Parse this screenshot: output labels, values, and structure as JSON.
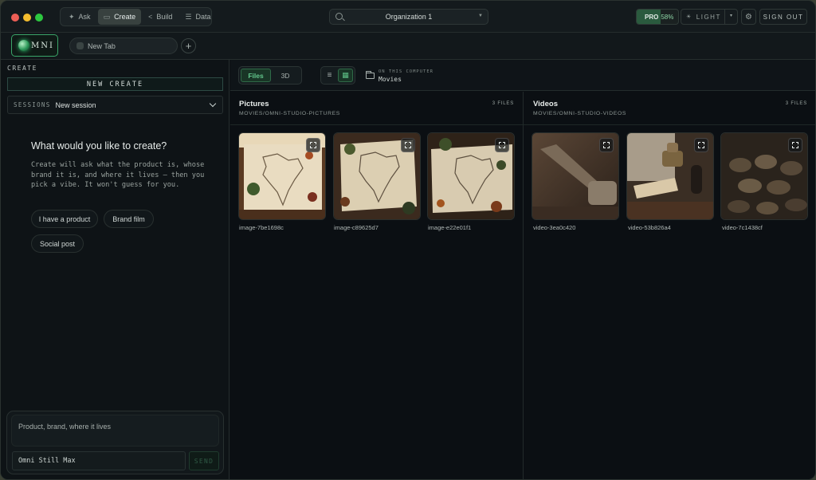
{
  "topbar": {
    "modes": [
      {
        "label": "Ask",
        "icon": "ask-icon",
        "active": false
      },
      {
        "label": "Create",
        "icon": "create-icon",
        "active": true
      },
      {
        "label": "Build",
        "icon": "build-icon",
        "active": false
      },
      {
        "label": "Data",
        "icon": "data-icon",
        "active": false
      }
    ],
    "organization": "Organization 1",
    "plan_label": "PRO",
    "plan_usage": "58%",
    "plan_usage_fraction": 0.58,
    "theme_label": "LIGHT",
    "sign_out_label": "SIGN OUT"
  },
  "tabbar": {
    "logo_text": "MNI",
    "tab_label": "New Tab"
  },
  "sidebar": {
    "section_label": "CREATE",
    "new_create_label": "NEW CREATE",
    "sessions_label": "SESSIONS",
    "session_value": "New session",
    "prompt_title": "What would you like to create?",
    "prompt_description": "Create will ask what the product is, whose brand it is, and where it lives — then you pick a vibe. It won't guess for you.",
    "chips": [
      "I have a product",
      "Brand film",
      "Social post"
    ],
    "composer_placeholder": "Product, brand, where it lives",
    "model": "Omni Still Max",
    "send_label": "SEND"
  },
  "main": {
    "view_tabs": [
      "Files",
      "3D"
    ],
    "active_view_tab": "Files",
    "location_caption": "ON THIS COMPUTER",
    "location_name": "Movies",
    "pictures": {
      "title": "Pictures",
      "path": "MOVIES/OMNI-STUDIO-PICTURES",
      "count": "3 FILES",
      "items": [
        "image-7be1698c",
        "image-c89625d7",
        "image-e22e01f1"
      ]
    },
    "videos": {
      "title": "Videos",
      "path": "MOVIES/OMNI-STUDIO-VIDEOS",
      "count": "3 FILES",
      "items": [
        "video-3ea0c420",
        "video-53b826a4",
        "video-7c1438cf"
      ]
    }
  },
  "colors": {
    "accent_green": "#3aa568",
    "background": "#0c1014",
    "panel": "#141a1d"
  }
}
